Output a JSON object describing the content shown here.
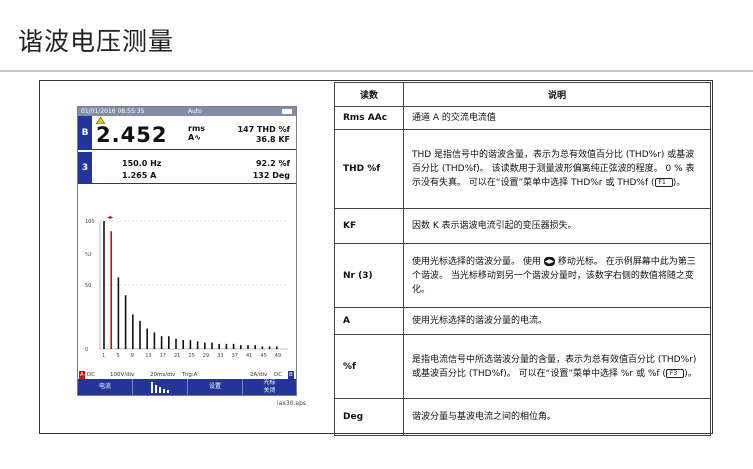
{
  "page_title": "谐波电压测量",
  "figure": {
    "status_bar": {
      "datetime": "01/01/2016 08:55:35",
      "mode": "Auto"
    },
    "readout_b": {
      "badge": "B",
      "value": "2.452",
      "unit_top": "rms",
      "unit_bottom": "A∿",
      "thd": "147 THD %f",
      "kf": "36.8 KF"
    },
    "readout_3": {
      "badge": "3",
      "freq": "150.0 Hz",
      "amp": "1.265 A",
      "pct": "92.2 %f",
      "deg": "132 Deg"
    },
    "plot": {
      "y_ticks": [
        "100",
        "%f",
        "50",
        "0"
      ],
      "x_ticks": [
        "1",
        "5",
        "9",
        "13",
        "17",
        "21",
        "25",
        "29",
        "33",
        "37",
        "41",
        "45",
        "49"
      ],
      "bars": [
        100,
        0,
        92,
        0,
        56,
        0,
        42,
        0,
        27,
        0,
        22,
        0,
        16,
        0,
        13,
        0,
        10,
        0,
        10,
        0,
        8,
        0,
        7,
        0,
        7,
        0,
        6,
        0,
        5,
        0,
        5,
        0,
        4,
        0,
        4,
        0,
        4,
        0,
        3,
        0,
        3,
        0,
        3,
        0,
        2,
        0,
        2,
        0,
        2
      ],
      "cursor_harmonic": 3
    },
    "status_line": {
      "left_badge": "A",
      "dc": "DC",
      "volt_div": "100V/div",
      "time_div": "20ms/div",
      "trig": "Trig:A",
      "right_div": "2A/div",
      "right_dc": "DC",
      "right_badge": "B"
    },
    "menu": [
      "电流",
      "",
      "设置",
      "光标\n关闭"
    ],
    "caption": "iax30.eps"
  },
  "table": {
    "headers": [
      "读数",
      "说明"
    ],
    "rows": [
      {
        "term": "Rms AAc",
        "desc": "通道 A 的交流电流值"
      },
      {
        "term": "THD %f",
        "desc": "THD 是指信号中的谐波含量，表示为总有效值百分比 (THD%r) 或基波百分比 (THD%f)。 该读数用于测量波形偏离纯正弦波的程度。 0 % 表示没有失真。 可以在“设置”菜单中选择 THD%r 或 THD%f (",
        "key": "F1",
        "desc_end": ")。"
      },
      {
        "term": "KF",
        "desc": "因数 K 表示谐波电流引起的变压器损失。"
      },
      {
        "term": "Nr (3)",
        "desc": "使用光标选择的谐波分量。 使用 ",
        "arrows": "◀▶",
        "desc_end": " 移动光标。 在示例屏幕中此为第三个谐波。 当光标移动到另一个谐波分量时，该数字右侧的数值将随之变化。"
      },
      {
        "term": "A",
        "desc": "使用光标选择的谐波分量的电流。"
      },
      {
        "term": "%f",
        "desc": "是指电流信号中所选谐波分量的含量，表示为总有效值百分比 (THD%r) 或基波百分比 (THD%f)。 可以在“设置”菜单中选择 %r 或 %f (",
        "key": "F3",
        "desc_end": ")。"
      },
      {
        "term": "Deg",
        "desc": "谐波分量与基波电流之间的相位角。"
      }
    ]
  }
}
